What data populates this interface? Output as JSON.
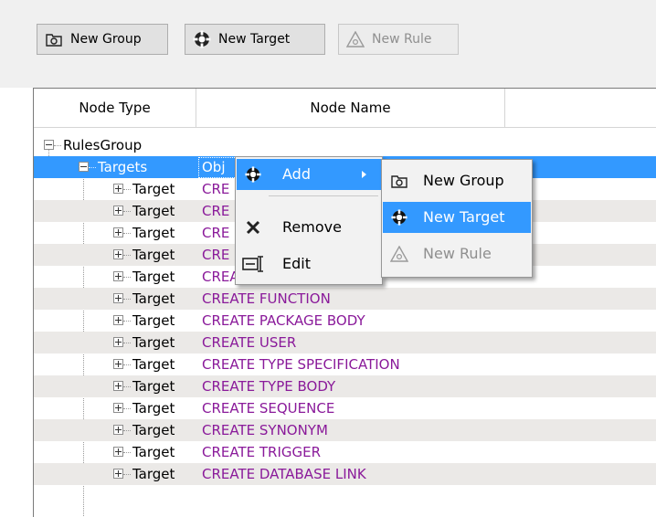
{
  "toolbar": {
    "new_group": "New Group",
    "new_target": "New Target",
    "new_rule": "New Rule"
  },
  "columns": [
    "Node Type",
    "Node Name"
  ],
  "tree": {
    "root": "RulesGroup",
    "targets_label": "Targets",
    "targets_name": "Obj",
    "rows": [
      {
        "type": "Target",
        "name": "CRE"
      },
      {
        "type": "Target",
        "name": "CRE"
      },
      {
        "type": "Target",
        "name": "CRE"
      },
      {
        "type": "Target",
        "name": "CRE"
      },
      {
        "type": "Target",
        "name": "CREATE PROCEDURE"
      },
      {
        "type": "Target",
        "name": "CREATE FUNCTION"
      },
      {
        "type": "Target",
        "name": "CREATE PACKAGE BODY"
      },
      {
        "type": "Target",
        "name": "CREATE USER"
      },
      {
        "type": "Target",
        "name": "CREATE TYPE SPECIFICATION"
      },
      {
        "type": "Target",
        "name": "CREATE TYPE BODY"
      },
      {
        "type": "Target",
        "name": "CREATE SEQUENCE"
      },
      {
        "type": "Target",
        "name": "CREATE SYNONYM"
      },
      {
        "type": "Target",
        "name": "CREATE TRIGGER"
      },
      {
        "type": "Target",
        "name": "CREATE DATABASE LINK"
      }
    ]
  },
  "context_menu": {
    "add": "Add",
    "remove": "Remove",
    "edit": "Edit"
  },
  "submenu": {
    "new_group": "New Group",
    "new_target": "New Target",
    "new_rule": "New Rule"
  },
  "colors": {
    "selection": "#3399ff",
    "node_name": "#8a1a9a",
    "alt_row": "#ebe9e7"
  }
}
